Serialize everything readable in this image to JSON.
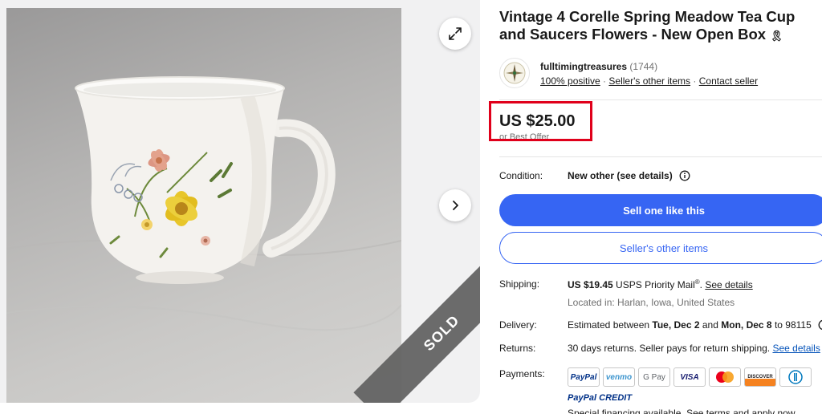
{
  "listing": {
    "title": "Vintage 4 Corelle Spring Meadow Tea Cup and Saucers Flowers - New Open Box",
    "title_badge": "🎗",
    "sold_label": "SOLD"
  },
  "seller": {
    "name": "fulltimingtreasures",
    "feedback_count": "(1744)",
    "positive": "100% positive",
    "sep1": " · ",
    "other_items_link": "Seller's other items",
    "sep2": " · ",
    "contact_link": "Contact seller"
  },
  "price": {
    "amount": "US $25.00",
    "best_offer": "or Best Offer"
  },
  "condition": {
    "label": "Condition:",
    "value": "New other (see details)"
  },
  "buttons": {
    "sell_one": "Sell one like this",
    "other_items": "Seller's other items"
  },
  "shipping": {
    "label": "Shipping:",
    "amount": "US $19.45",
    "service": " USPS Priority Mail",
    "reg": "®",
    "dot": ". ",
    "details_link": "See details",
    "location": "Located in: Harlan, Iowa, United States"
  },
  "delivery": {
    "label": "Delivery:",
    "prefix": "Estimated between ",
    "start": "Tue, Dec 2",
    "and": " and ",
    "end": "Mon, Dec 8",
    "suffix": " to 98115"
  },
  "returns": {
    "label": "Returns:",
    "text": "30 days returns. Seller pays for return shipping. ",
    "details_link": "See details"
  },
  "payments": {
    "label": "Payments:",
    "methods": [
      "PayPal",
      "venmo",
      "G Pay",
      "VISA",
      "Mastercard",
      "DISCOVER",
      "Diners Club"
    ],
    "paypal_credit": "PayPal CREDIT",
    "financing": "Special financing available. See terms and apply now"
  },
  "colors": {
    "primary": "#3665f3",
    "highlight": "#e0001b",
    "link_blue": "#0654ba"
  },
  "icons": {
    "expand": "expand-icon",
    "next": "chevron-right-icon",
    "info": "info-icon"
  }
}
